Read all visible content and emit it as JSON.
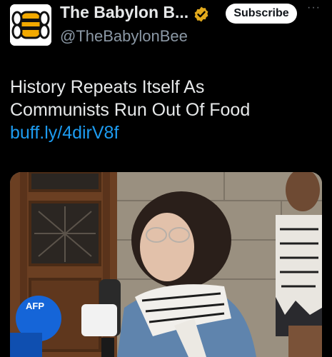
{
  "account": {
    "display_name": "The Babylon B...",
    "handle": "@TheBabylonBee",
    "verified": true,
    "subscribe_label": "Subscribe",
    "more_label": "···"
  },
  "post": {
    "line1": "History Repeats Itself As",
    "line2": "Communists Run Out Of Food",
    "link": "buff.ly/4dirV8f"
  },
  "media": {
    "mic_label": "AFP",
    "colors": {
      "link": "#1d9bf0",
      "verified_badge": "#e2a91c",
      "mic_blue": "#1565d8"
    }
  }
}
